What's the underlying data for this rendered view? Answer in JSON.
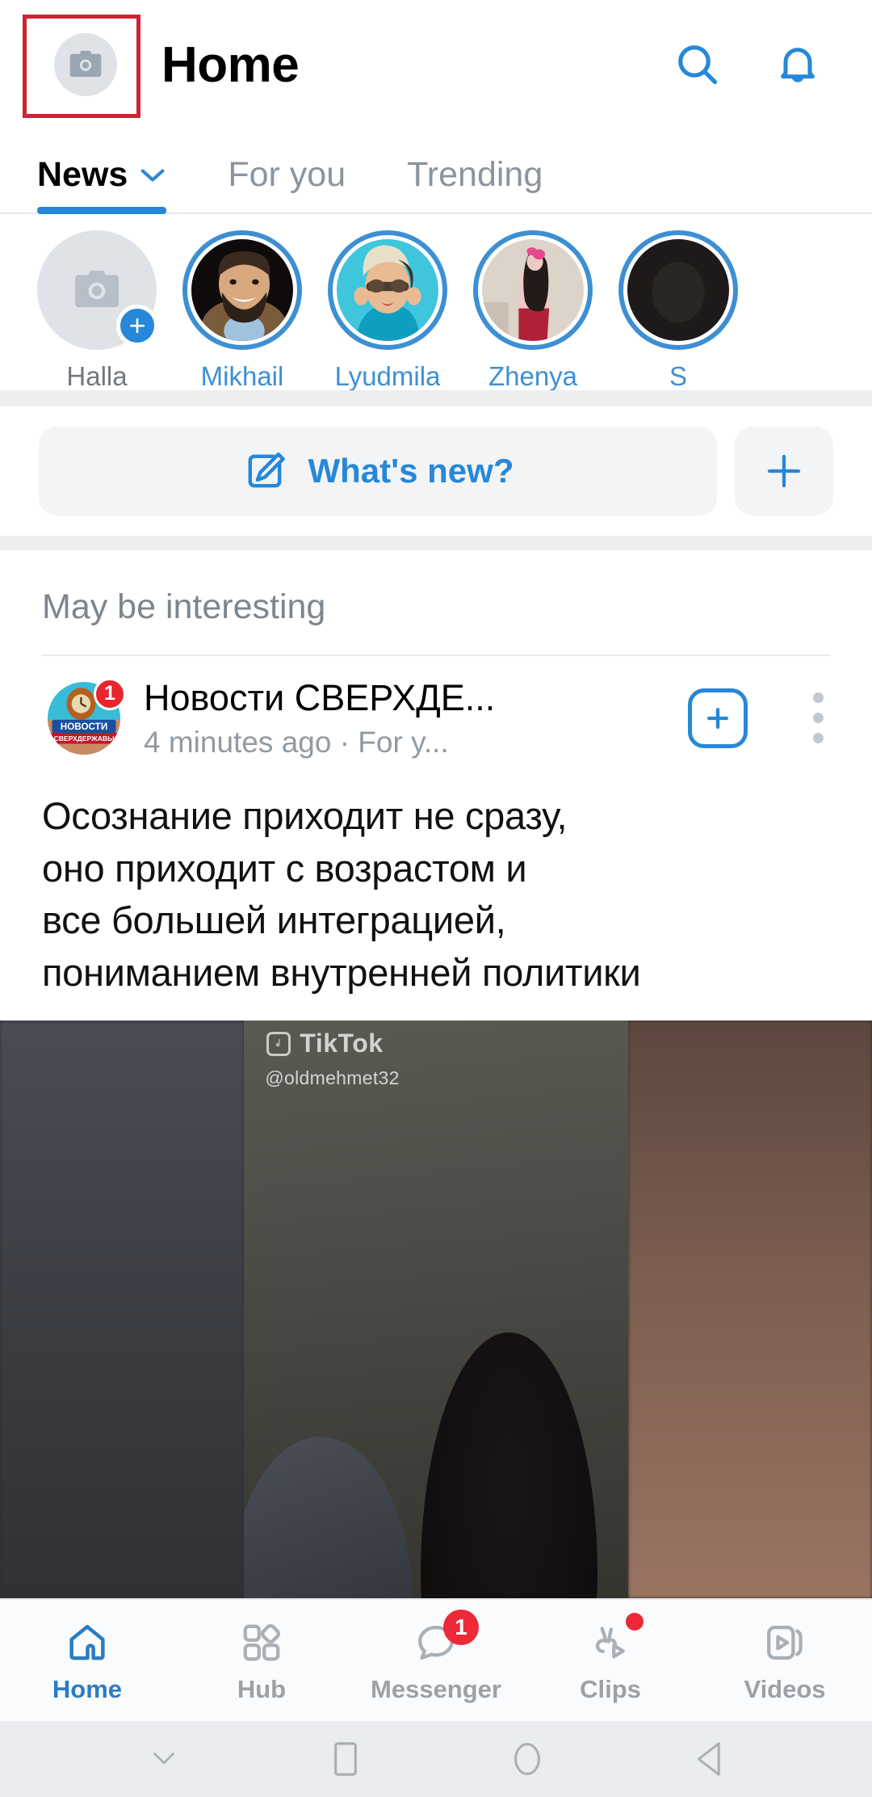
{
  "header": {
    "title": "Home",
    "avatar_icon": "camera-placeholder-icon",
    "search_icon": "search-icon",
    "notifications_icon": "bell-icon"
  },
  "annotation": {
    "type": "highlight-box",
    "color": "#cf2233",
    "target": "profile-avatar-button"
  },
  "tabs": [
    {
      "label": "News",
      "active": true,
      "has_chevron": true
    },
    {
      "label": "For you",
      "active": false,
      "has_chevron": false
    },
    {
      "label": "Trending",
      "active": false,
      "has_chevron": false
    }
  ],
  "stories": [
    {
      "name": "Halla",
      "type": "add",
      "ring": false,
      "badge": "+"
    },
    {
      "name": "Mikhail",
      "type": "photo",
      "ring": true
    },
    {
      "name": "Lyudmila",
      "type": "photo",
      "ring": true
    },
    {
      "name": "Zhenya",
      "type": "photo",
      "ring": true
    },
    {
      "name": "S",
      "type": "photo",
      "ring": true
    }
  ],
  "composer": {
    "whats_new_label": "What's new?",
    "edit_icon": "edit-pencil-icon",
    "add_icon": "plus-icon"
  },
  "feed": {
    "section_title": "May be interesting",
    "post": {
      "author": "Новости СВЕРХДЕ...",
      "avatar_badge": "1",
      "avatar_logo_line1": "НОВОСТИ",
      "avatar_logo_line2": "СВЕРХДЕРЖАВЫ",
      "subtitle": "4 minutes ago · For y...",
      "subscribe_icon": "plus-square-icon",
      "more_icon": "kebab-menu-icon",
      "text_lines": [
        "Осознание приходит не сразу,",
        "оно приходит с возрастом и",
        "все большей интеграцией,",
        "пониманием внутренней политики"
      ],
      "media": {
        "watermark": "TikTok",
        "handle": "@oldmehmet32"
      }
    }
  },
  "bottom_nav": [
    {
      "label": "Home",
      "icon": "home-icon",
      "active": true,
      "badge": null,
      "dot": false
    },
    {
      "label": "Hub",
      "icon": "hub-grid-icon",
      "active": false,
      "badge": null,
      "dot": false
    },
    {
      "label": "Messenger",
      "icon": "chat-bubble-icon",
      "active": false,
      "badge": "1",
      "dot": false
    },
    {
      "label": "Clips",
      "icon": "clips-icon",
      "active": false,
      "badge": null,
      "dot": true
    },
    {
      "label": "Videos",
      "icon": "video-card-icon",
      "active": false,
      "badge": null,
      "dot": false
    }
  ],
  "system_nav": [
    {
      "icon": "chevron-down-icon"
    },
    {
      "icon": "recents-square-icon"
    },
    {
      "icon": "home-circle-icon"
    },
    {
      "icon": "back-triangle-icon"
    }
  ],
  "colors": {
    "accent": "#2787d8",
    "story_ring": "#3d8fd4",
    "badge_red": "#ed2839",
    "annotation": "#cf2233"
  }
}
